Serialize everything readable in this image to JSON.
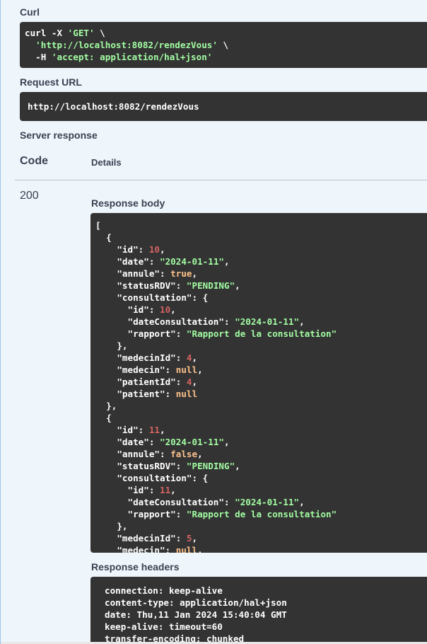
{
  "curl": {
    "label": "Curl",
    "line1_a": "curl -X ",
    "line1_b": "'GET'",
    "line1_c": " \\",
    "line2_a": "  ",
    "line2_b": "'http://localhost:8082/rendezVous'",
    "line2_c": " \\",
    "line3_a": "  -H ",
    "line3_b": "'accept: application/hal+json'"
  },
  "request_url": {
    "label": "Request URL",
    "value": "http://localhost:8082/rendezVous"
  },
  "server_response": {
    "label": "Server response",
    "code_header": "Code",
    "details_header": "Details",
    "status_code": "200",
    "body_label": "Response body",
    "headers_label": "Response headers"
  },
  "response_body": [
    [
      [
        "p",
        "["
      ]
    ],
    [
      [
        "p",
        "  {"
      ]
    ],
    [
      [
        "p",
        "    \"id\": "
      ],
      [
        "n",
        "10"
      ],
      [
        "p",
        ","
      ]
    ],
    [
      [
        "p",
        "    \"date\": "
      ],
      [
        "s",
        "\"2024-01-11\""
      ],
      [
        "p",
        ","
      ]
    ],
    [
      [
        "p",
        "    \"annule\": "
      ],
      [
        "b",
        "true"
      ],
      [
        "p",
        ","
      ]
    ],
    [
      [
        "p",
        "    \"statusRDV\": "
      ],
      [
        "s",
        "\"PENDING\""
      ],
      [
        "p",
        ","
      ]
    ],
    [
      [
        "p",
        "    \"consultation\": {"
      ]
    ],
    [
      [
        "p",
        "      \"id\": "
      ],
      [
        "n",
        "10"
      ],
      [
        "p",
        ","
      ]
    ],
    [
      [
        "p",
        "      \"dateConsultation\": "
      ],
      [
        "s",
        "\"2024-01-11\""
      ],
      [
        "p",
        ","
      ]
    ],
    [
      [
        "p",
        "      \"rapport\": "
      ],
      [
        "s",
        "\"Rapport de la consultation\""
      ]
    ],
    [
      [
        "p",
        "    },"
      ]
    ],
    [
      [
        "p",
        "    \"medecinId\": "
      ],
      [
        "n",
        "4"
      ],
      [
        "p",
        ","
      ]
    ],
    [
      [
        "p",
        "    \"medecin\": "
      ],
      [
        "b",
        "null"
      ],
      [
        "p",
        ","
      ]
    ],
    [
      [
        "p",
        "    \"patientId\": "
      ],
      [
        "n",
        "4"
      ],
      [
        "p",
        ","
      ]
    ],
    [
      [
        "p",
        "    \"patient\": "
      ],
      [
        "b",
        "null"
      ]
    ],
    [
      [
        "p",
        "  },"
      ]
    ],
    [
      [
        "p",
        "  {"
      ]
    ],
    [
      [
        "p",
        "    \"id\": "
      ],
      [
        "n",
        "11"
      ],
      [
        "p",
        ","
      ]
    ],
    [
      [
        "p",
        "    \"date\": "
      ],
      [
        "s",
        "\"2024-01-11\""
      ],
      [
        "p",
        ","
      ]
    ],
    [
      [
        "p",
        "    \"annule\": "
      ],
      [
        "b",
        "false"
      ],
      [
        "p",
        ","
      ]
    ],
    [
      [
        "p",
        "    \"statusRDV\": "
      ],
      [
        "s",
        "\"PENDING\""
      ],
      [
        "p",
        ","
      ]
    ],
    [
      [
        "p",
        "    \"consultation\": {"
      ]
    ],
    [
      [
        "p",
        "      \"id\": "
      ],
      [
        "n",
        "11"
      ],
      [
        "p",
        ","
      ]
    ],
    [
      [
        "p",
        "      \"dateConsultation\": "
      ],
      [
        "s",
        "\"2024-01-11\""
      ],
      [
        "p",
        ","
      ]
    ],
    [
      [
        "p",
        "      \"rapport\": "
      ],
      [
        "s",
        "\"Rapport de la consultation\""
      ]
    ],
    [
      [
        "p",
        "    },"
      ]
    ],
    [
      [
        "p",
        "    \"medecinId\": "
      ],
      [
        "n",
        "5"
      ],
      [
        "p",
        ","
      ]
    ],
    [
      [
        "p",
        "    \"medecin\": "
      ],
      [
        "b",
        "null"
      ],
      [
        "p",
        ","
      ]
    ]
  ],
  "response_headers": [
    "connection: keep-alive",
    "content-type: application/hal+json",
    "date: Thu,11 Jan 2024 15:40:04 GMT",
    "keep-alive: timeout=60",
    "transfer-encoding: chunked"
  ],
  "colors": {
    "code_bg": "#333333",
    "string": "#a2fca2",
    "number": "#d36363",
    "literal": "#fcc28c",
    "label": "#3b4151"
  }
}
